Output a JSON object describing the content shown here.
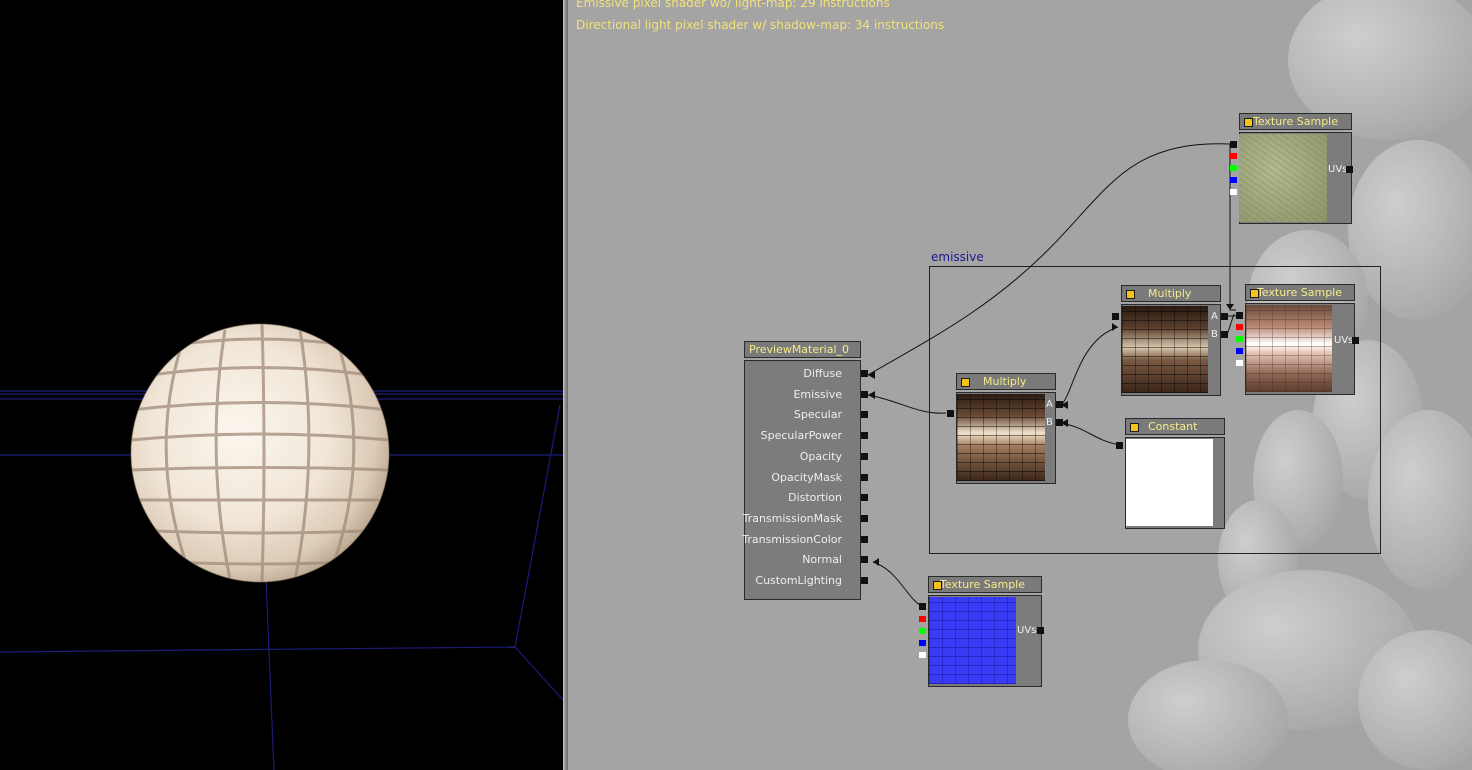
{
  "stats": {
    "emissive_line": "Emissive pixel shader wo/ light-map: 29 instructions",
    "directional_line": "Directional light pixel shader w/ shadow-map: 34 instructions"
  },
  "colors": {
    "canvas_bg": "#a4a4a4",
    "viewport_bg": "#000000",
    "stats_text": "#f2e27a",
    "node_title_text": "#f6ec8a",
    "group_label": "#1a1a8c",
    "grid_line": "#1c1c7a",
    "channel_red": "#ff0000",
    "channel_green": "#00ff00",
    "channel_blue": "#0000ff",
    "channel_alpha": "#ffffff"
  },
  "group": {
    "label": "emissive"
  },
  "material_node": {
    "title": "PreviewMaterial_0",
    "inputs": [
      "Diffuse",
      "Emissive",
      "Specular",
      "SpecularPower",
      "Opacity",
      "OpacityMask",
      "Distortion",
      "TransmissionMask",
      "TransmissionColor",
      "Normal",
      "CustomLighting"
    ]
  },
  "nodes": {
    "texture_top": {
      "title": "Texture Sample",
      "uvs": "UVs"
    },
    "texture_mid": {
      "title": "Texture Sample",
      "uvs": "UVs"
    },
    "texture_bottom": {
      "title": "Texture Sample",
      "uvs": "UVs"
    },
    "multiply_top": {
      "title": "Multiply",
      "a": "A",
      "b": "B"
    },
    "multiply_bottom": {
      "title": "Multiply",
      "a": "A",
      "b": "B"
    },
    "constant": {
      "title": "Constant"
    }
  },
  "icons": {
    "node_indicator": "yellow-square-indicator-icon",
    "pin": "black-square-connector-icon"
  }
}
